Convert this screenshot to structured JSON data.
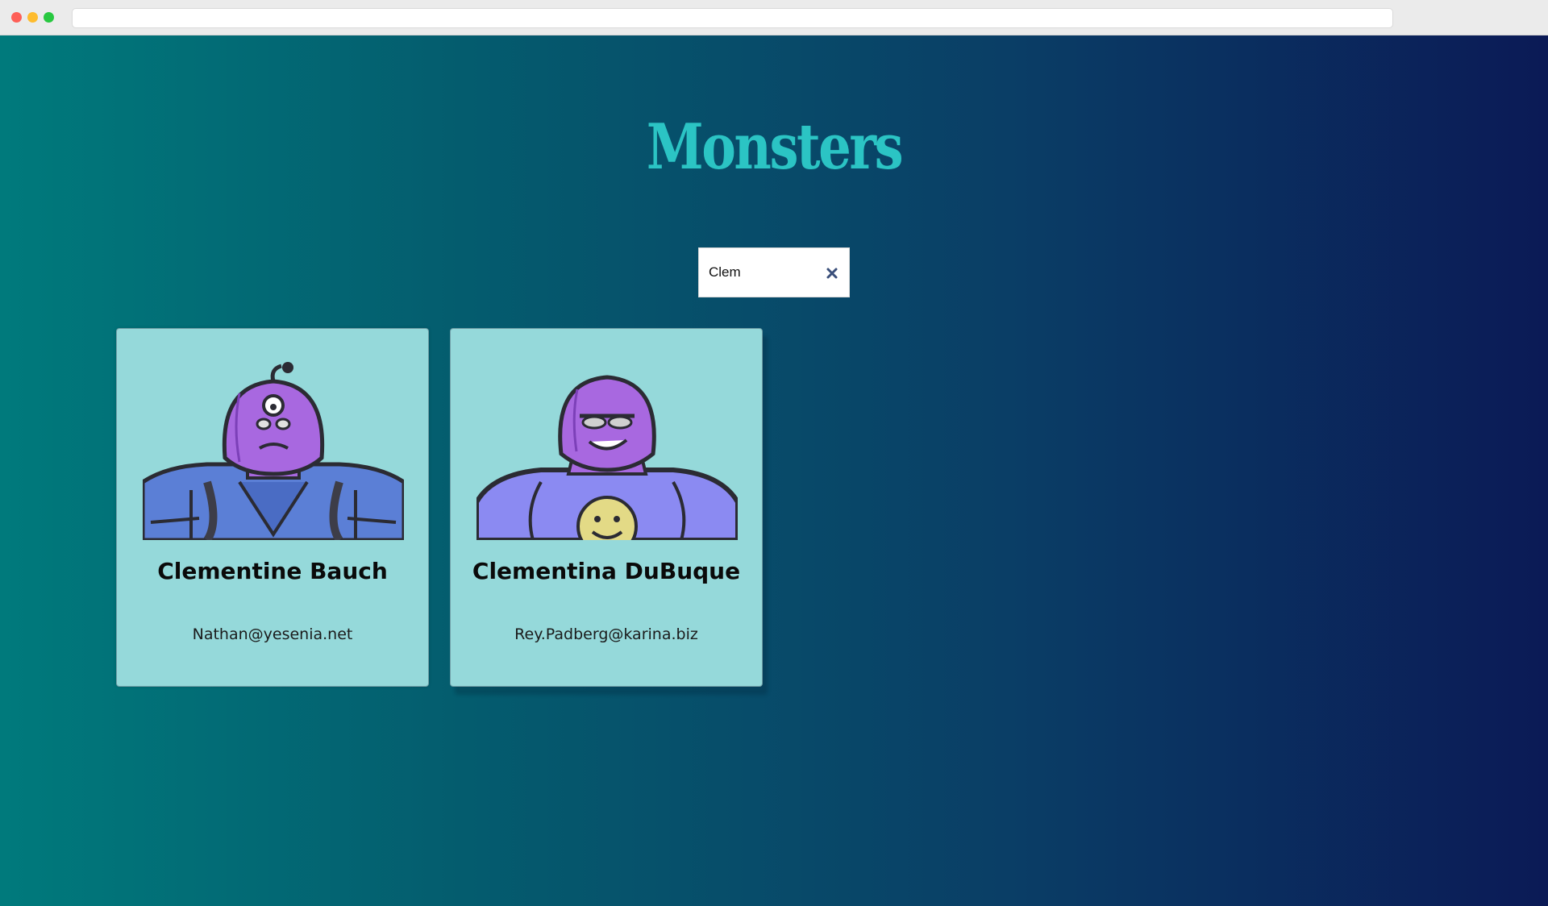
{
  "app": {
    "title": "Monsters"
  },
  "search": {
    "value": "Clem",
    "clear_icon": "close-icon"
  },
  "monsters": [
    {
      "name": "Clementine Bauch",
      "email": "Nathan@yesenia.net",
      "image_icon": "robot-monster-avatar"
    },
    {
      "name": "Clementina DuBuque",
      "email": "Rey.Padberg@karina.biz",
      "image_icon": "robot-monster-avatar"
    }
  ],
  "colors": {
    "title": "#2bc4c4",
    "card_bg": "#95d9da",
    "gradient_start": "#007a7c",
    "gradient_end": "#0b1a56"
  }
}
